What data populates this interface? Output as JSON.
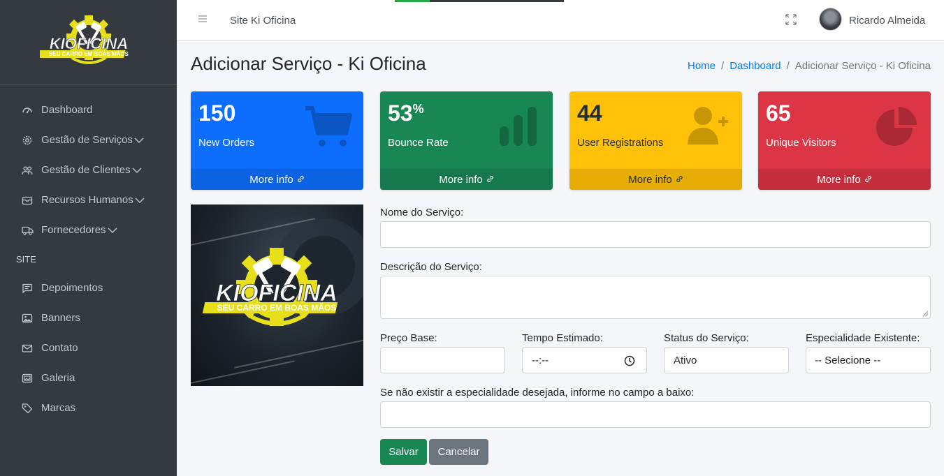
{
  "brand": {
    "logo_title": "KIOFICINA",
    "logo_subtitle": "SEU CARRO EM BOAS MÃOS",
    "accent_color": "#f5e600"
  },
  "sidebar": {
    "items": [
      {
        "label": "Dashboard",
        "icon": "dashboard-gauge-icon"
      },
      {
        "label": "Gestão de Serviços",
        "icon": "gear-icon",
        "expandable": true
      },
      {
        "label": "Gestão de Clientes",
        "icon": "people-icon",
        "expandable": true
      },
      {
        "label": "Recursos Humanos",
        "icon": "inbox-icon",
        "expandable": true
      },
      {
        "label": "Fornecedores",
        "icon": "truck-icon",
        "expandable": true
      }
    ],
    "section_header": "SITE",
    "site_items": [
      {
        "label": "Depoimentos",
        "icon": "chat-icon"
      },
      {
        "label": "Banners",
        "icon": "image-icon"
      },
      {
        "label": "Contato",
        "icon": "envelope-icon"
      },
      {
        "label": "Galeria",
        "icon": "images-icon"
      },
      {
        "label": "Marcas",
        "icon": "tags-icon"
      }
    ]
  },
  "topbar": {
    "site_link": "Site Ki Oficina",
    "user_name": "Ricardo Almeida"
  },
  "page": {
    "title": "Adicionar Serviço - Ki Oficina",
    "breadcrumb": [
      "Home",
      "Dashboard",
      "Adicionar Serviço - Ki Oficina"
    ]
  },
  "boxes": [
    {
      "value": "150",
      "suffix": "",
      "label": "New Orders",
      "footer": "More info",
      "color": "#0d6efd",
      "icon": "cart-icon"
    },
    {
      "value": "53",
      "suffix": "%",
      "label": "Bounce Rate",
      "footer": "More info",
      "color": "#198754",
      "icon": "bar-chart-icon"
    },
    {
      "value": "44",
      "suffix": "",
      "label": "User Registrations",
      "footer": "More info",
      "color": "#ffc107",
      "icon": "user-plus-icon"
    },
    {
      "value": "65",
      "suffix": "",
      "label": "Unique Visitors",
      "footer": "More info",
      "color": "#dc3545",
      "icon": "pie-chart-icon"
    }
  ],
  "form": {
    "nome_label": "Nome do Serviço:",
    "nome_value": "",
    "descricao_label": "Descrição do Serviço:",
    "descricao_value": "",
    "preco_label": "Preço Base:",
    "preco_value": "",
    "tempo_label": "Tempo Estimado:",
    "tempo_value": "--:--",
    "status_label": "Status do Serviço:",
    "status_value": "Ativo",
    "especialidade_label": "Especialidade Existente:",
    "especialidade_value": "-- Selecione --",
    "nova_especialidade_label": "Se não existir a especialidade desejada, informe no campo a baixo:",
    "nova_especialidade_value": "",
    "save_label": "Salvar",
    "cancel_label": "Cancelar"
  }
}
